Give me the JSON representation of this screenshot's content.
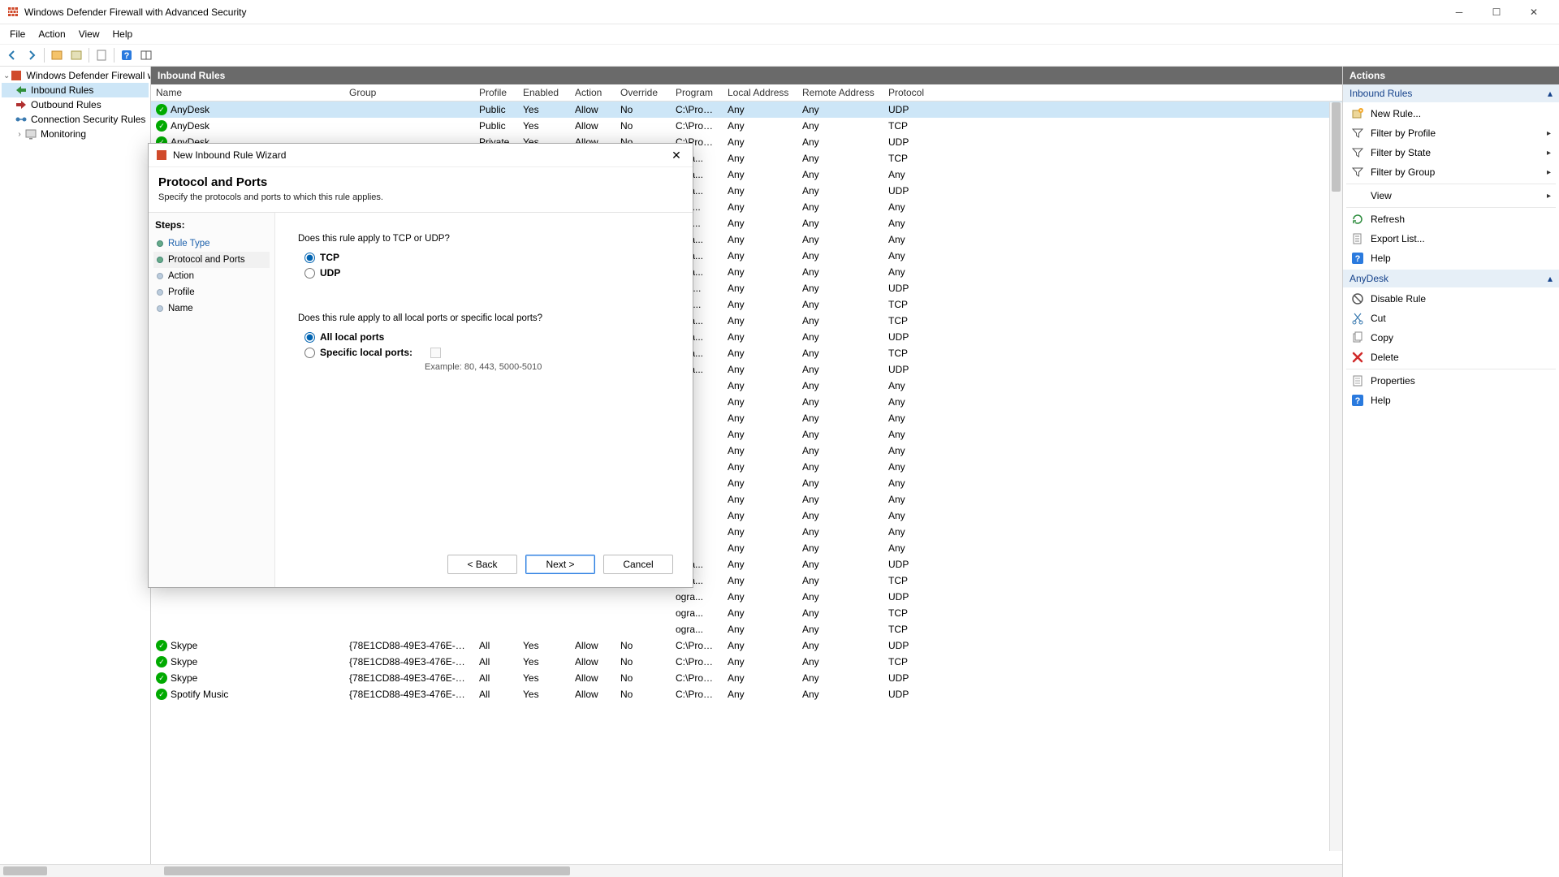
{
  "window": {
    "title": "Windows Defender Firewall with Advanced Security"
  },
  "menu": {
    "file": "File",
    "action": "Action",
    "view": "View",
    "help": "Help"
  },
  "tree": {
    "root": "Windows Defender Firewall with",
    "inbound": "Inbound Rules",
    "outbound": "Outbound Rules",
    "conn": "Connection Security Rules",
    "monitoring": "Monitoring"
  },
  "center": {
    "title": "Inbound Rules",
    "cols": {
      "name": "Name",
      "group": "Group",
      "profile": "Profile",
      "enabled": "Enabled",
      "action": "Action",
      "override": "Override",
      "program": "Program",
      "laddr": "Local Address",
      "raddr": "Remote Address",
      "proto": "Protocol"
    },
    "rows": [
      {
        "name": "AnyDesk",
        "group": "",
        "profile": "Public",
        "enabled": "Yes",
        "action": "Allow",
        "override": "No",
        "program": "C:\\Progra...",
        "laddr": "Any",
        "raddr": "Any",
        "proto": "UDP",
        "sel": true
      },
      {
        "name": "AnyDesk",
        "group": "",
        "profile": "Public",
        "enabled": "Yes",
        "action": "Allow",
        "override": "No",
        "program": "C:\\Progra...",
        "laddr": "Any",
        "raddr": "Any",
        "proto": "TCP"
      },
      {
        "name": "AnyDesk",
        "group": "",
        "profile": "Private",
        "enabled": "Yes",
        "action": "Allow",
        "override": "No",
        "program": "C:\\Progra...",
        "laddr": "Any",
        "raddr": "Any",
        "proto": "UDP"
      },
      {
        "name": "",
        "group": "",
        "profile": "",
        "enabled": "",
        "action": "",
        "override": "",
        "program": "ogra...",
        "laddr": "Any",
        "raddr": "Any",
        "proto": "TCP"
      },
      {
        "name": "",
        "group": "",
        "profile": "",
        "enabled": "",
        "action": "",
        "override": "",
        "program": "ogra...",
        "laddr": "Any",
        "raddr": "Any",
        "proto": "Any"
      },
      {
        "name": "",
        "group": "",
        "profile": "",
        "enabled": "",
        "action": "",
        "override": "",
        "program": "ogra...",
        "laddr": "Any",
        "raddr": "Any",
        "proto": "UDP"
      },
      {
        "name": "",
        "group": "",
        "profile": "",
        "enabled": "",
        "action": "",
        "override": "",
        "program": "IND...",
        "laddr": "Any",
        "raddr": "Any",
        "proto": "Any"
      },
      {
        "name": "",
        "group": "",
        "profile": "",
        "enabled": "",
        "action": "",
        "override": "",
        "program": "IND...",
        "laddr": "Any",
        "raddr": "Any",
        "proto": "Any"
      },
      {
        "name": "",
        "group": "",
        "profile": "",
        "enabled": "",
        "action": "",
        "override": "",
        "program": "ogra...",
        "laddr": "Any",
        "raddr": "Any",
        "proto": "Any"
      },
      {
        "name": "",
        "group": "",
        "profile": "",
        "enabled": "",
        "action": "",
        "override": "",
        "program": "ogra...",
        "laddr": "Any",
        "raddr": "Any",
        "proto": "Any"
      },
      {
        "name": "",
        "group": "",
        "profile": "",
        "enabled": "",
        "action": "",
        "override": "",
        "program": "ogra...",
        "laddr": "Any",
        "raddr": "Any",
        "proto": "Any"
      },
      {
        "name": "",
        "group": "",
        "profile": "",
        "enabled": "",
        "action": "",
        "override": "",
        "program": "re-a...",
        "laddr": "Any",
        "raddr": "Any",
        "proto": "UDP"
      },
      {
        "name": "",
        "group": "",
        "profile": "",
        "enabled": "",
        "action": "",
        "override": "",
        "program": "re-a...",
        "laddr": "Any",
        "raddr": "Any",
        "proto": "TCP"
      },
      {
        "name": "",
        "group": "",
        "profile": "",
        "enabled": "",
        "action": "",
        "override": "",
        "program": "ogra...",
        "laddr": "Any",
        "raddr": "Any",
        "proto": "TCP"
      },
      {
        "name": "",
        "group": "",
        "profile": "",
        "enabled": "",
        "action": "",
        "override": "",
        "program": "ogra...",
        "laddr": "Any",
        "raddr": "Any",
        "proto": "UDP"
      },
      {
        "name": "",
        "group": "",
        "profile": "",
        "enabled": "",
        "action": "",
        "override": "",
        "program": "ogra...",
        "laddr": "Any",
        "raddr": "Any",
        "proto": "TCP"
      },
      {
        "name": "",
        "group": "",
        "profile": "",
        "enabled": "",
        "action": "",
        "override": "",
        "program": "ogra...",
        "laddr": "Any",
        "raddr": "Any",
        "proto": "UDP"
      },
      {
        "name": "",
        "group": "",
        "profile": "",
        "enabled": "",
        "action": "",
        "override": "",
        "program": "",
        "laddr": "Any",
        "raddr": "Any",
        "proto": "Any"
      },
      {
        "name": "",
        "group": "",
        "profile": "",
        "enabled": "",
        "action": "",
        "override": "",
        "program": "",
        "laddr": "Any",
        "raddr": "Any",
        "proto": "Any"
      },
      {
        "name": "",
        "group": "",
        "profile": "",
        "enabled": "",
        "action": "",
        "override": "",
        "program": "",
        "laddr": "Any",
        "raddr": "Any",
        "proto": "Any"
      },
      {
        "name": "",
        "group": "",
        "profile": "",
        "enabled": "",
        "action": "",
        "override": "",
        "program": "",
        "laddr": "Any",
        "raddr": "Any",
        "proto": "Any"
      },
      {
        "name": "",
        "group": "",
        "profile": "",
        "enabled": "",
        "action": "",
        "override": "",
        "program": "",
        "laddr": "Any",
        "raddr": "Any",
        "proto": "Any"
      },
      {
        "name": "",
        "group": "",
        "profile": "",
        "enabled": "",
        "action": "",
        "override": "",
        "program": "",
        "laddr": "Any",
        "raddr": "Any",
        "proto": "Any"
      },
      {
        "name": "",
        "group": "",
        "profile": "",
        "enabled": "",
        "action": "",
        "override": "",
        "program": "",
        "laddr": "Any",
        "raddr": "Any",
        "proto": "Any"
      },
      {
        "name": "",
        "group": "",
        "profile": "",
        "enabled": "",
        "action": "",
        "override": "",
        "program": "",
        "laddr": "Any",
        "raddr": "Any",
        "proto": "Any"
      },
      {
        "name": "",
        "group": "",
        "profile": "",
        "enabled": "",
        "action": "",
        "override": "",
        "program": "",
        "laddr": "Any",
        "raddr": "Any",
        "proto": "Any"
      },
      {
        "name": "",
        "group": "",
        "profile": "",
        "enabled": "",
        "action": "",
        "override": "",
        "program": "",
        "laddr": "Any",
        "raddr": "Any",
        "proto": "Any"
      },
      {
        "name": "",
        "group": "",
        "profile": "",
        "enabled": "",
        "action": "",
        "override": "",
        "program": "",
        "laddr": "Any",
        "raddr": "Any",
        "proto": "Any"
      },
      {
        "name": "",
        "group": "",
        "profile": "",
        "enabled": "",
        "action": "",
        "override": "",
        "program": "ogra...",
        "laddr": "Any",
        "raddr": "Any",
        "proto": "UDP"
      },
      {
        "name": "",
        "group": "",
        "profile": "",
        "enabled": "",
        "action": "",
        "override": "",
        "program": "ogra...",
        "laddr": "Any",
        "raddr": "Any",
        "proto": "TCP"
      },
      {
        "name": "",
        "group": "",
        "profile": "",
        "enabled": "",
        "action": "",
        "override": "",
        "program": "ogra...",
        "laddr": "Any",
        "raddr": "Any",
        "proto": "UDP"
      },
      {
        "name": "",
        "group": "",
        "profile": "",
        "enabled": "",
        "action": "",
        "override": "",
        "program": "ogra...",
        "laddr": "Any",
        "raddr": "Any",
        "proto": "TCP"
      },
      {
        "name": "",
        "group": "",
        "profile": "",
        "enabled": "",
        "action": "",
        "override": "",
        "program": "ogra...",
        "laddr": "Any",
        "raddr": "Any",
        "proto": "TCP"
      },
      {
        "name": "Skype",
        "group": "{78E1CD88-49E3-476E-B926-...",
        "profile": "All",
        "enabled": "Yes",
        "action": "Allow",
        "override": "No",
        "program": "C:\\Progra...",
        "laddr": "Any",
        "raddr": "Any",
        "proto": "UDP"
      },
      {
        "name": "Skype",
        "group": "{78E1CD88-49E3-476E-B926-...",
        "profile": "All",
        "enabled": "Yes",
        "action": "Allow",
        "override": "No",
        "program": "C:\\Progra...",
        "laddr": "Any",
        "raddr": "Any",
        "proto": "TCP"
      },
      {
        "name": "Skype",
        "group": "{78E1CD88-49E3-476E-B926-...",
        "profile": "All",
        "enabled": "Yes",
        "action": "Allow",
        "override": "No",
        "program": "C:\\Progra...",
        "laddr": "Any",
        "raddr": "Any",
        "proto": "UDP"
      },
      {
        "name": "Spotify Music",
        "group": "{78E1CD88-49E3-476E-B926-...",
        "profile": "All",
        "enabled": "Yes",
        "action": "Allow",
        "override": "No",
        "program": "C:\\Progra...",
        "laddr": "Any",
        "raddr": "Any",
        "proto": "UDP"
      }
    ]
  },
  "actions": {
    "title": "Actions",
    "section1": "Inbound Rules",
    "newrule": "New Rule...",
    "fprofile": "Filter by Profile",
    "fstate": "Filter by State",
    "fgroup": "Filter by Group",
    "view": "View",
    "refresh": "Refresh",
    "export": "Export List...",
    "help1": "Help",
    "section2": "AnyDesk",
    "disable": "Disable Rule",
    "cut": "Cut",
    "copy": "Copy",
    "delete": "Delete",
    "props": "Properties",
    "help2": "Help"
  },
  "dialog": {
    "title": "New Inbound Rule Wizard",
    "heading": "Protocol and Ports",
    "subheading": "Specify the protocols and ports to which this rule applies.",
    "steps_label": "Steps:",
    "steps": {
      "rule_type": "Rule Type",
      "proto": "Protocol and Ports",
      "action": "Action",
      "profile": "Profile",
      "name": "Name"
    },
    "q1": "Does this rule apply to TCP or UDP?",
    "tcp": "TCP",
    "udp": "UDP",
    "q2": "Does this rule apply to all local ports or specific local ports?",
    "allports": "All local ports",
    "specific": "Specific local ports:",
    "example": "Example: 80, 443, 5000-5010",
    "back": "< Back",
    "next": "Next >",
    "cancel": "Cancel"
  }
}
